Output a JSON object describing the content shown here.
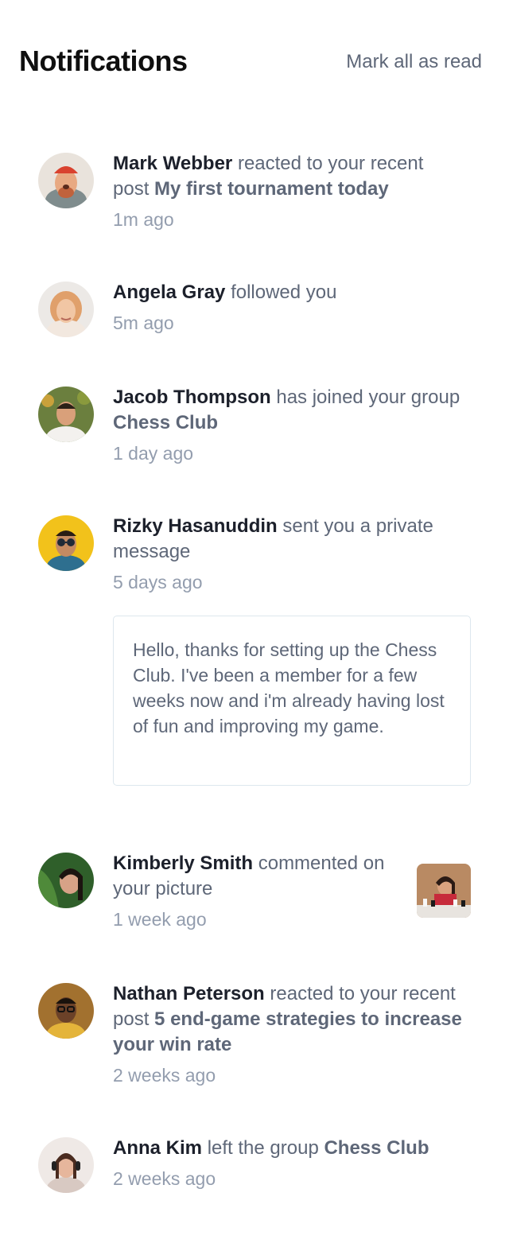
{
  "header": {
    "title": "Notifications",
    "mark_all": "Mark all as read"
  },
  "notifications": [
    {
      "name": "Mark Webber",
      "action": "reacted to your recent post",
      "target": "My first tournament today",
      "time": "1m ago",
      "avatar_icon": "avatar-mark-webber"
    },
    {
      "name": "Angela Gray",
      "action": "followed you",
      "time": "5m ago",
      "avatar_icon": "avatar-angela-gray"
    },
    {
      "name": "Jacob Thompson",
      "action": "has joined your group",
      "target": "Chess Club",
      "time": "1 day ago",
      "avatar_icon": "avatar-jacob-thompson"
    },
    {
      "name": "Rizky Hasanuddin",
      "action": "sent you a private message",
      "time": "5 days ago",
      "message": "Hello, thanks for setting up the Chess Club. I've been a member for a few weeks now and i'm already having lost of fun and improving my game.",
      "avatar_icon": "avatar-rizky-hasanuddin"
    },
    {
      "name": "Kimberly Smith",
      "action": "commented on your picture",
      "time": "1 week ago",
      "avatar_icon": "avatar-kimberly-smith",
      "thumbnail_icon": "chess-picture-thumbnail"
    },
    {
      "name": "Nathan Peterson",
      "action": "reacted to your recent post",
      "target": "5 end-game strategies to increase your win rate",
      "time": "2 weeks ago",
      "avatar_icon": "avatar-nathan-peterson"
    },
    {
      "name": "Anna Kim",
      "action": "left the group",
      "target": "Chess Club",
      "time": "2 weeks ago",
      "avatar_icon": "avatar-anna-kim"
    }
  ]
}
